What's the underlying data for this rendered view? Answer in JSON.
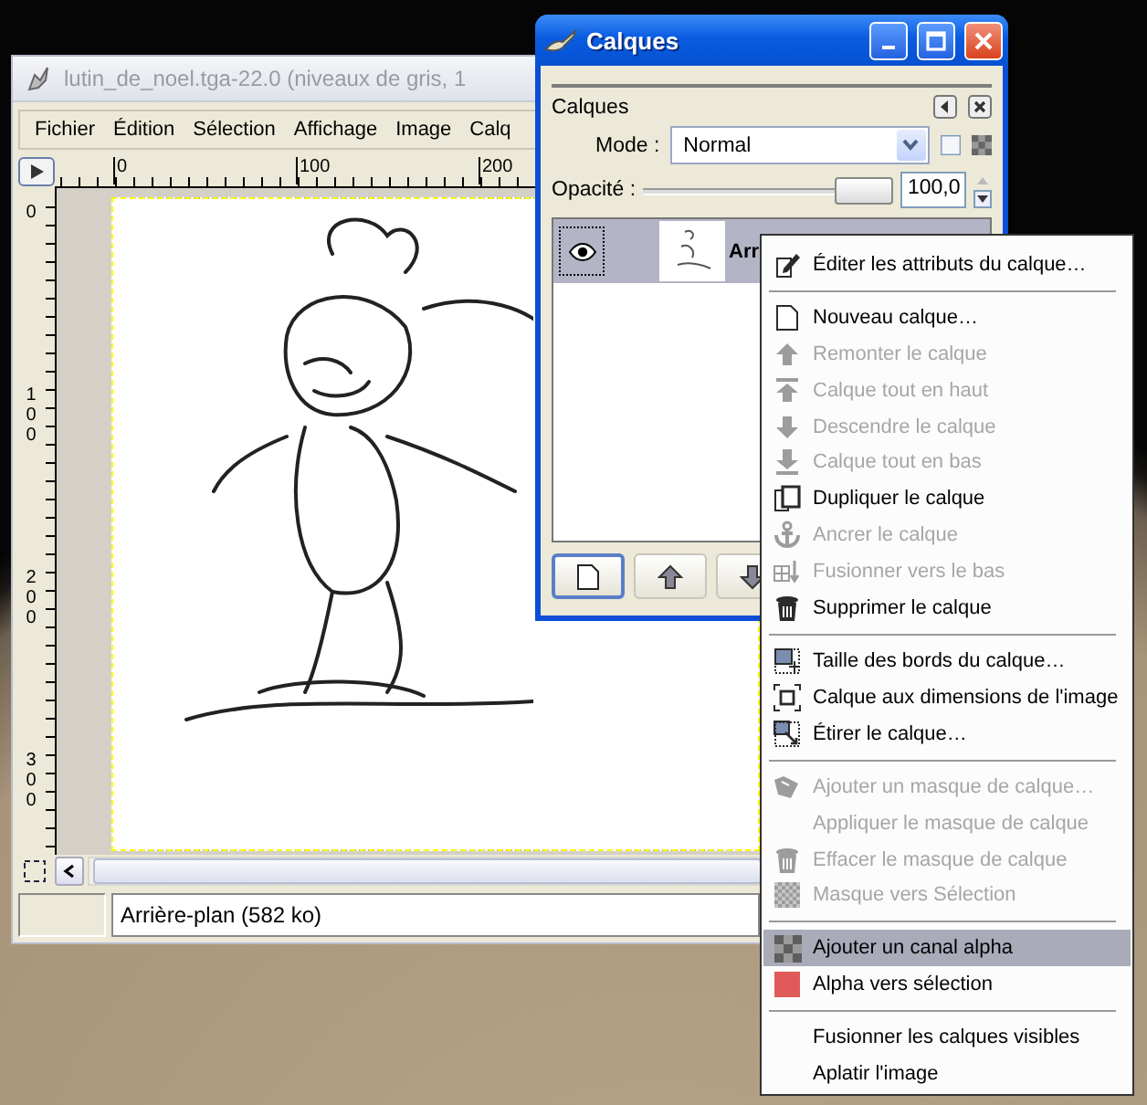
{
  "image_window": {
    "title": "lutin_de_noel.tga-22.0 (niveaux de gris, 1",
    "menu": [
      {
        "label": "Fichier"
      },
      {
        "label": "Édition"
      },
      {
        "label": "Sélection"
      },
      {
        "label": "Affichage"
      },
      {
        "label": "Image"
      },
      {
        "label": "Calq"
      }
    ],
    "ruler_h": [
      "0",
      "100",
      "200"
    ],
    "ruler_v": [
      "0",
      "100",
      "200",
      "300"
    ],
    "status": "Arrière-plan (582 ko)"
  },
  "layers_dialog": {
    "title": "Calques",
    "tab": "Calques",
    "mode_label": "Mode :",
    "mode": "Normal",
    "opacity_label": "Opacité :",
    "opacity": {
      "level": 1,
      "reading": "100,0"
    },
    "layers": [
      {
        "name": "Arr",
        "selected": true,
        "visible": true
      }
    ]
  },
  "context_menu": {
    "items": [
      {
        "kind": "item",
        "label": "Éditer les attributs du calque…",
        "disabled": false,
        "selected": false
      },
      {
        "kind": "separator"
      },
      {
        "kind": "item",
        "label": "Nouveau calque…",
        "disabled": false,
        "selected": false
      },
      {
        "kind": "item",
        "label": "Remonter le calque",
        "disabled": true,
        "selected": false
      },
      {
        "kind": "item",
        "label": "Calque tout en haut",
        "disabled": true,
        "selected": false
      },
      {
        "kind": "item",
        "label": "Descendre le calque",
        "disabled": true,
        "selected": false
      },
      {
        "kind": "item",
        "label": "Calque tout en bas",
        "disabled": true,
        "selected": false
      },
      {
        "kind": "item",
        "label": "Dupliquer le calque",
        "disabled": false,
        "selected": false
      },
      {
        "kind": "item",
        "label": "Ancrer le calque",
        "disabled": true,
        "selected": false
      },
      {
        "kind": "item",
        "label": "Fusionner vers le bas",
        "disabled": true,
        "selected": false
      },
      {
        "kind": "item",
        "label": "Supprimer le calque",
        "disabled": false,
        "selected": false
      },
      {
        "kind": "separator"
      },
      {
        "kind": "item",
        "label": "Taille des bords du calque…",
        "disabled": false,
        "selected": false
      },
      {
        "kind": "item",
        "label": "Calque aux dimensions de l'image",
        "disabled": false,
        "selected": false
      },
      {
        "kind": "item",
        "label": "Étirer le calque…",
        "disabled": false,
        "selected": false
      },
      {
        "kind": "separator"
      },
      {
        "kind": "item",
        "label": "Ajouter un masque de calque…",
        "disabled": true,
        "selected": false
      },
      {
        "kind": "item",
        "label": "Appliquer le masque de calque",
        "disabled": true,
        "selected": false
      },
      {
        "kind": "item",
        "label": "Effacer le masque de calque",
        "disabled": true,
        "selected": false
      },
      {
        "kind": "item",
        "label": "Masque vers Sélection",
        "disabled": true,
        "selected": false
      },
      {
        "kind": "separator"
      },
      {
        "kind": "item",
        "label": "Ajouter un canal alpha",
        "disabled": false,
        "selected": true
      },
      {
        "kind": "item",
        "label": "Alpha vers sélection",
        "disabled": false,
        "selected": false
      },
      {
        "kind": "separator"
      },
      {
        "kind": "item",
        "label": "Fusionner les calques visibles",
        "disabled": false,
        "selected": false
      },
      {
        "kind": "item",
        "label": "Aplatir l'image",
        "disabled": false,
        "selected": false
      }
    ]
  }
}
